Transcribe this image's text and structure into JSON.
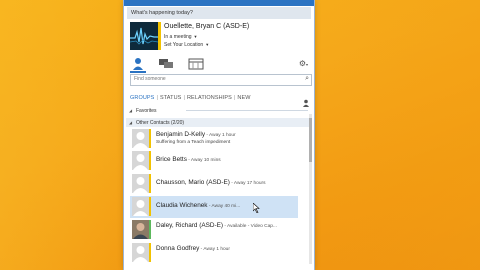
{
  "window": {
    "whats_happening": "What's happening today?",
    "user_name": "Ouellette, Bryan C (ASD-E)",
    "status": "In a meeting",
    "location": "Set Your Location",
    "search_placeholder": "Find someone"
  },
  "filters": {
    "groups": "GROUPS",
    "status": "STATUS",
    "relationships": "RELATIONSHIPS",
    "new": "NEW"
  },
  "groups": [
    {
      "label": "Favorites"
    },
    {
      "label": "Other Contacts (2/20)"
    }
  ],
  "contacts": [
    {
      "name": "Benjamin D-Kelly",
      "sub": " - Away 1 hour",
      "note": "Suffering from a Teach impediment"
    },
    {
      "name": "Brice Betts",
      "sub": " - Away 10 mins",
      "note": ""
    },
    {
      "name": "Chausson, Mario (ASD-E)",
      "sub": " - Away 17 hours",
      "note": ""
    },
    {
      "name": "Claudia Wichenek",
      "sub": " - Away 40 mi...",
      "note": ""
    },
    {
      "name": "Daley, Richard (ASD-E)",
      "sub": " - Available - Video Cap...",
      "note": ""
    },
    {
      "name": "Donna Godfrey",
      "sub": " - Away 1 hour",
      "note": ""
    }
  ],
  "colors": {
    "accent": "#2b73c2",
    "presence_away": "#f2c200",
    "desktop": "#f5a81a"
  }
}
